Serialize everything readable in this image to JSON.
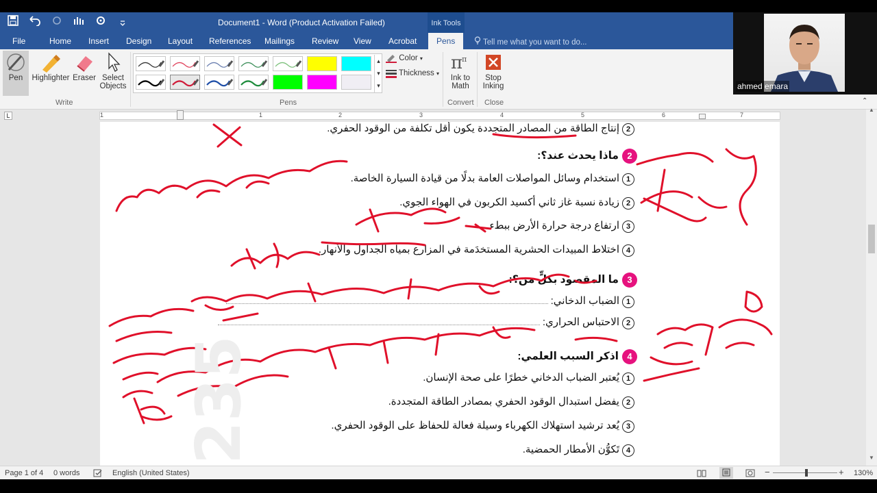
{
  "window": {
    "title": "Document1 - Word (Product Activation Failed)",
    "contextual_tab_group": "Ink Tools"
  },
  "tabs": [
    "File",
    "Home",
    "Insert",
    "Design",
    "Layout",
    "References",
    "Mailings",
    "Review",
    "View",
    "Acrobat",
    "Pens"
  ],
  "active_tab": "Pens",
  "tell_me_placeholder": "Tell me what you want to do...",
  "ribbon": {
    "write": {
      "group_label": "Write",
      "pen": "Pen",
      "highlighter": "Highlighter",
      "eraser": "Eraser",
      "select_objects_line1": "Select",
      "select_objects_line2": "Objects"
    },
    "pens": {
      "group_label": "Pens",
      "color": "Color",
      "thickness": "Thickness"
    },
    "convert": {
      "group_label": "Convert",
      "ink_to_math_line1": "Ink to",
      "ink_to_math_line2": "Math"
    },
    "close": {
      "group_label": "Close",
      "stop_inking_line1": "Stop",
      "stop_inking_line2": "Inking"
    },
    "pen_swatch_colors": [
      "#333333",
      "#e0405a",
      "#6a7fb0",
      "#3d8f5a",
      "#7bc07a",
      "#ffff00",
      "#00ffff",
      "#000000",
      "#d01c3a",
      "#1f4fa8",
      "#1e8c3c",
      "#00ff00",
      "#ff00ff",
      "#f0eef4"
    ]
  },
  "webcam": {
    "name": "ahmed emara"
  },
  "ruler_numbers": [
    "1",
    "1",
    "2",
    "3",
    "4",
    "5",
    "6",
    "7"
  ],
  "document": {
    "top_line": "إنتاج الطاقة من المصادر المتجددة يكون أقل تكلفة من الوقود الحفري.",
    "top_line_num": "2",
    "q2": {
      "num": "2",
      "title": "ماذا يحدث عند؟:",
      "items": [
        {
          "num": "1",
          "text": "استخدام وسائل المواصلات العامة بدلًا من قيادة السيارة الخاصة."
        },
        {
          "num": "2",
          "text": "زيادة نسبة غاز ثاني أكسيد الكربون في الهواء الجوي."
        },
        {
          "num": "3",
          "text": "ارتفاع درجة حرارة الأرض ببطء."
        },
        {
          "num": "4",
          "text": "اختلاط المبيدات الحشرية المستخدَمة في المزارع بمياه الجداول والأنهار."
        }
      ]
    },
    "q3": {
      "num": "3",
      "title": "ما المقصود بكلٍّ من؟:",
      "items": [
        {
          "num": "1",
          "text": "الضباب الدخاني:"
        },
        {
          "num": "2",
          "text": "الاحتباس الحراري:"
        }
      ]
    },
    "q4": {
      "num": "4",
      "title": "اذكر السبب العلمي:",
      "items": [
        {
          "num": "1",
          "text": "يُعتبر الضباب الدخاني خطرًا على صحة الإنسان."
        },
        {
          "num": "2",
          "text": "يفضل استبدال الوقود الحفري بمصادر الطاقة المتجددة."
        },
        {
          "num": "3",
          "text": "يُعد ترشيد استهلاك الكهرباء وسيلة فعالة للحفاظ على الوقود الحفري."
        },
        {
          "num": "4",
          "text": "تَكوُّن الأمطار الحمضية."
        }
      ]
    },
    "ink_color": "#e0102a"
  },
  "status": {
    "page": "Page 1 of 4",
    "words": "0 words",
    "language": "English (United States)",
    "zoom": "130%"
  }
}
